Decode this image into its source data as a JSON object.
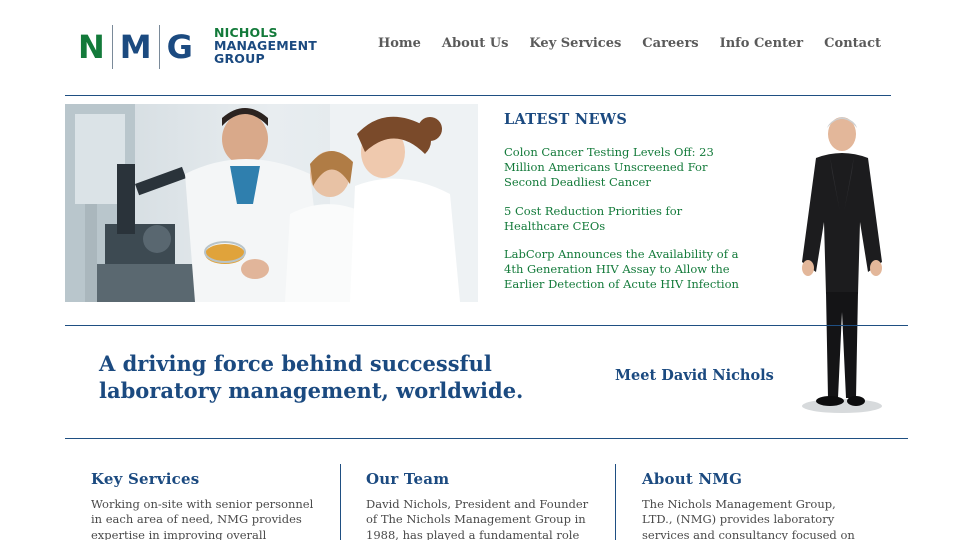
{
  "logo": {
    "letters": [
      "N",
      "M",
      "G"
    ],
    "name_lines": [
      "NICHOLS",
      "MANAGEMENT",
      "GROUP"
    ]
  },
  "nav": {
    "items": [
      "Home",
      "About Us",
      "Key Services",
      "Careers",
      "Info Center",
      "Contact"
    ]
  },
  "news": {
    "title": "LATEST NEWS",
    "items": [
      "Colon Cancer Testing Levels Off: 23 Million Americans Unscreened For Second Deadliest Cancer",
      "5 Cost Reduction Priorities for Healthcare CEOs",
      "LabCorp Announces the Availability of a 4th Generation HIV Assay to Allow the Earlier Detection of Acute HIV Infection"
    ]
  },
  "tagline": "A driving force behind successful laboratory management, worldwide.",
  "meet_link": "Meet David Nichols",
  "columns": [
    {
      "title": "Key Services",
      "text": "Working on-site with senior personnel in each area of need, NMG provides expertise in improving overall"
    },
    {
      "title": "Our Team",
      "text": "David Nichols, President and Founder of The Nichols Management Group in 1988, has played a fundamental role in the field"
    },
    {
      "title": "About NMG",
      "text": "The Nichols Management Group, LTD., (NMG) provides laboratory services and consultancy focused on lowering costs,"
    }
  ],
  "colors": {
    "brand_blue": "#1b4a80",
    "brand_green": "#137a3a",
    "nav_gray": "#5a5a5a",
    "rule": "#1f4f82"
  }
}
